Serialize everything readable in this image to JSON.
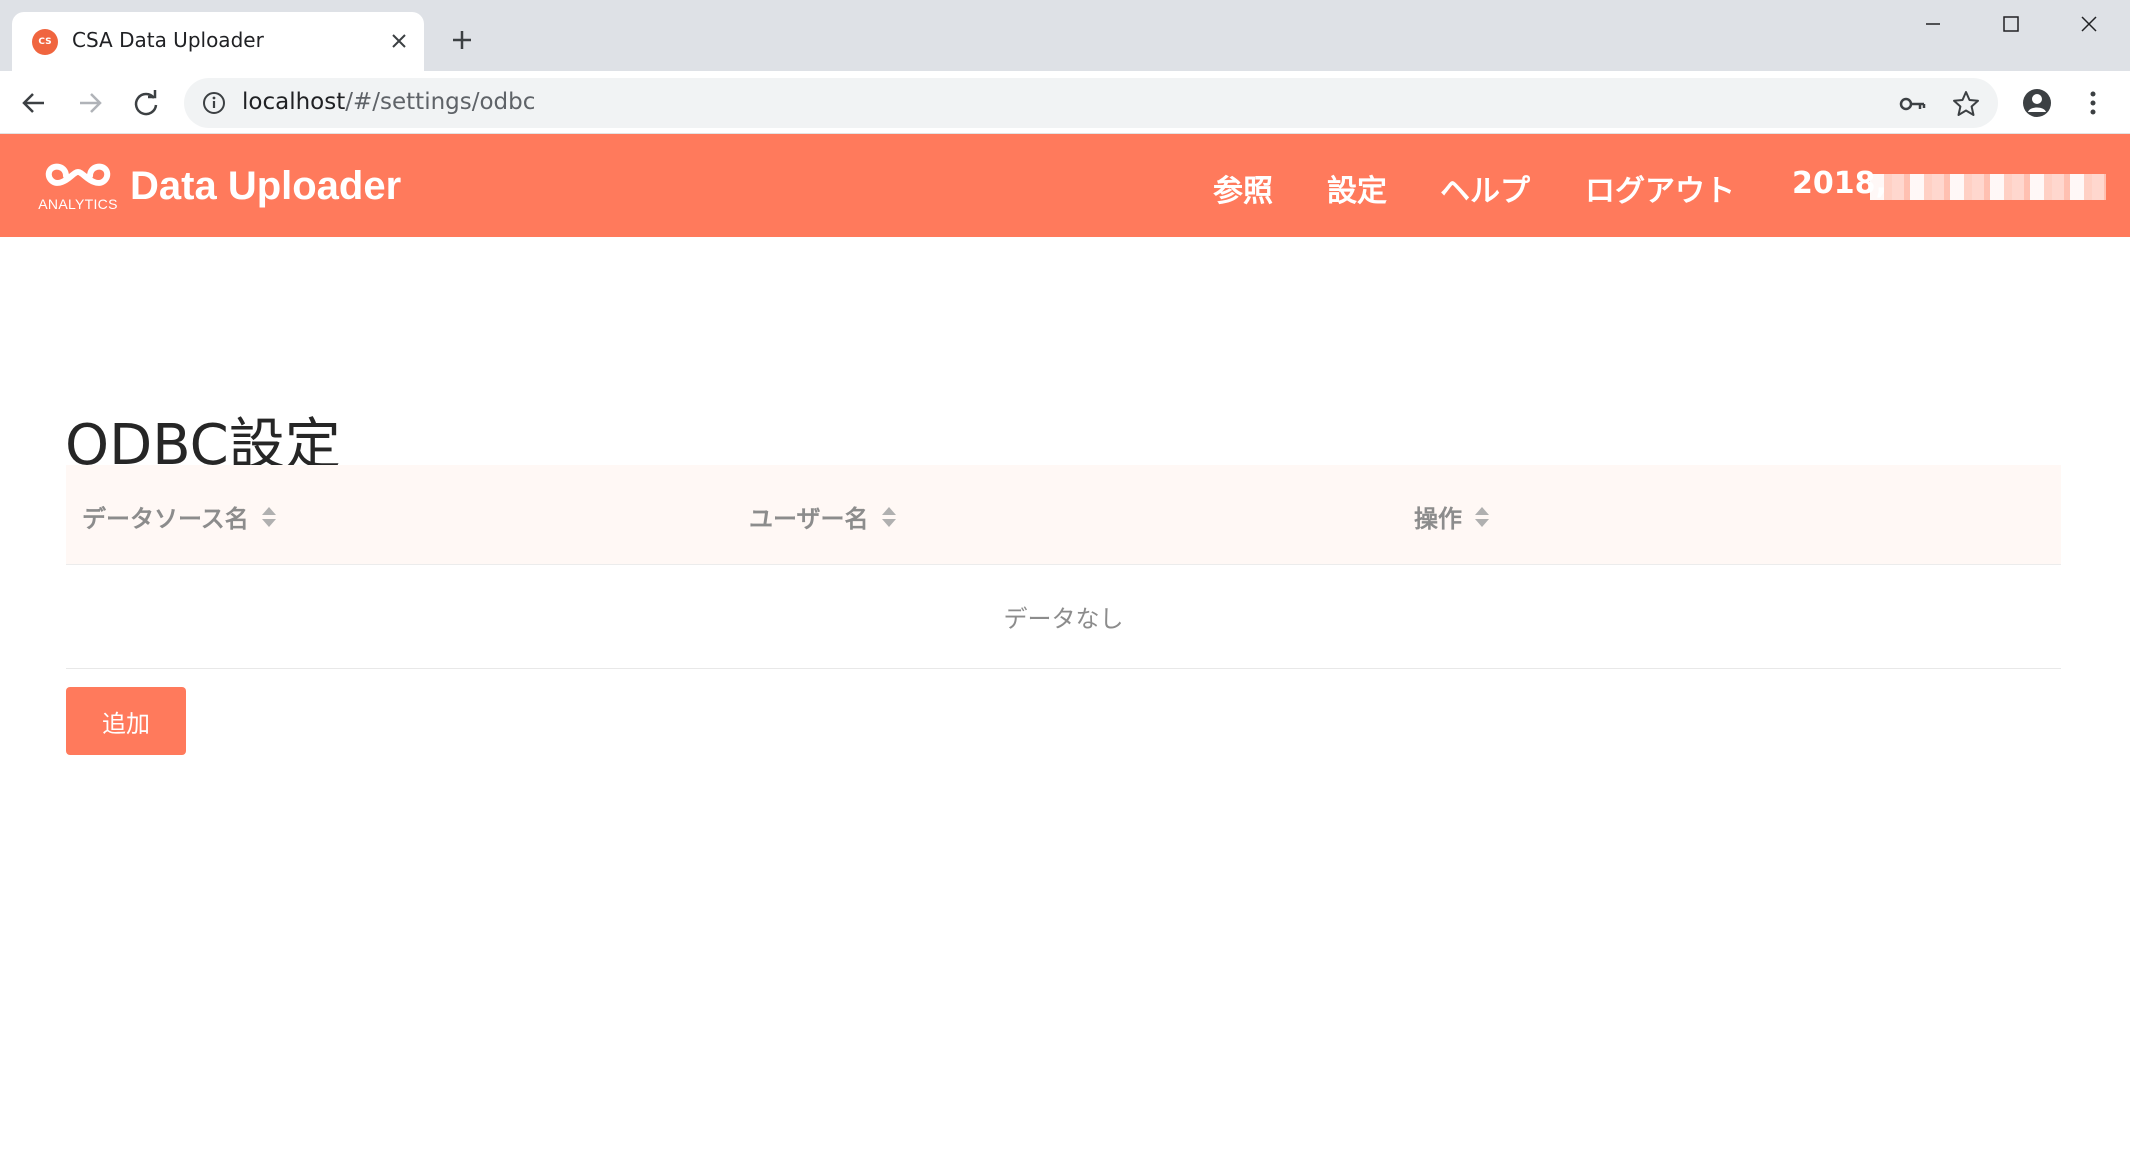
{
  "browser": {
    "tab_title": "CSA Data Uploader",
    "favicon_text": "CS",
    "url_host": "localhost",
    "url_path": "/#/settings/odbc"
  },
  "header": {
    "logo_caption": "ANALYTICS",
    "app_title": "Data Uploader",
    "nav": {
      "browse": "参照",
      "settings": "設定",
      "help": "ヘルプ",
      "logout": "ログアウト"
    },
    "user_prefix": "2018,"
  },
  "page": {
    "title": "ODBC設定"
  },
  "table": {
    "columns": [
      "データソース名",
      "ユーザー名",
      "操作"
    ],
    "empty_text": "データなし"
  },
  "actions": {
    "add_label": "追加"
  },
  "colors": {
    "brand": "#ff7a5c",
    "header_row_bg": "#fff8f5",
    "text_muted": "#8c8c8c"
  }
}
